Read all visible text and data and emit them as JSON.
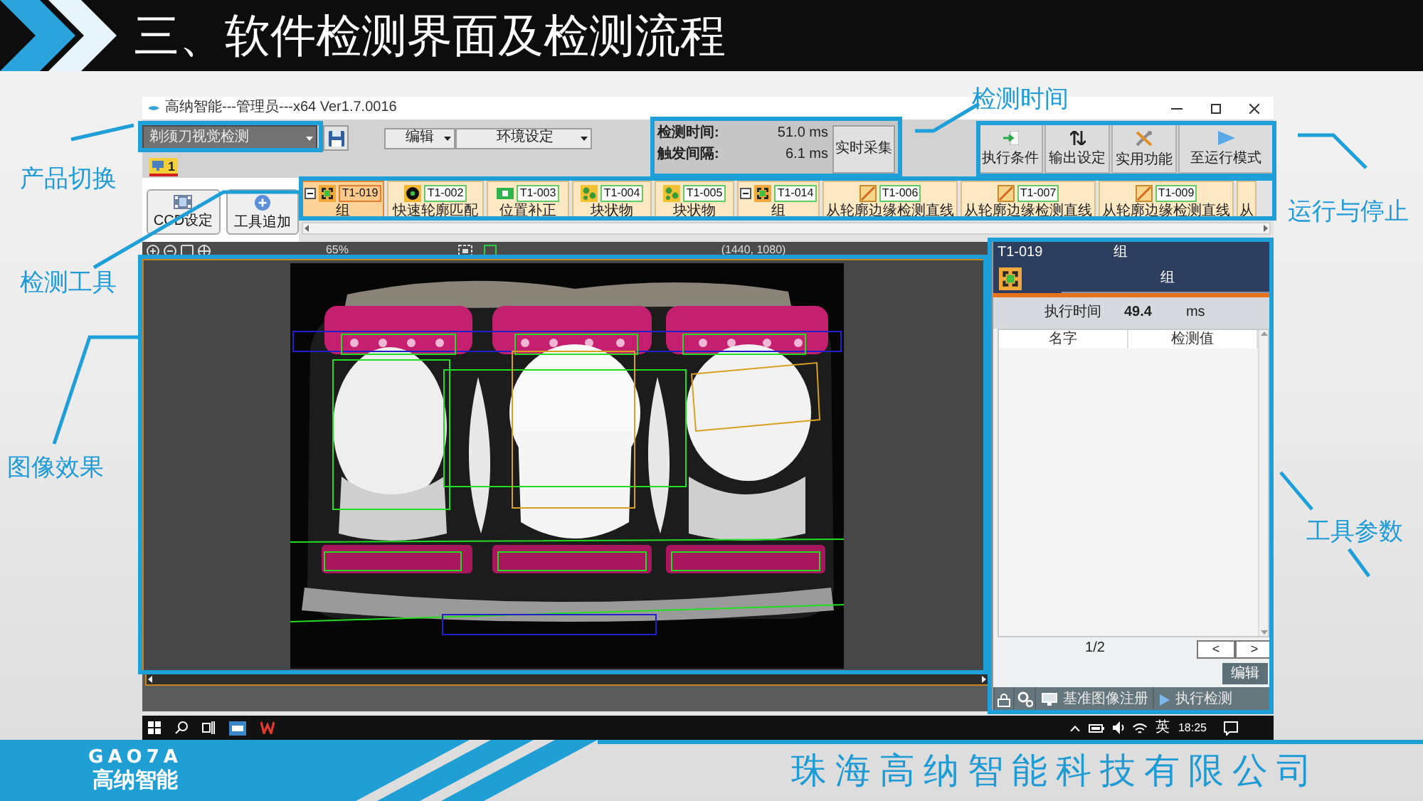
{
  "slide": {
    "title": "三、软件检测界面及检测流程"
  },
  "callouts": [
    {
      "text": "检测时间"
    },
    {
      "text": "产品切换"
    },
    {
      "text": "运行与停止"
    },
    {
      "text": "检测工具"
    },
    {
      "text": "图像效果"
    },
    {
      "text": "工具参数"
    }
  ],
  "window": {
    "title": "高纳智能---管理员---x64 Ver1.7.0016"
  },
  "toolbar": {
    "product": "剃须刀视觉检测",
    "menus": [
      "编辑",
      "环境设定"
    ],
    "stats": [
      {
        "label": "检测时间:",
        "value": "51.0 ms"
      },
      {
        "label": "触发间隔:",
        "value": "6.1 ms"
      }
    ],
    "live_button": "实时采集",
    "actions": [
      {
        "label": "执行条件",
        "kind": "condition"
      },
      {
        "label": "输出设定",
        "kind": "output"
      },
      {
        "label": "实用功能",
        "kind": "tools"
      },
      {
        "label": "至运行模式",
        "kind": "run"
      }
    ]
  },
  "page_tabs": [
    {
      "label": "1",
      "selected": true
    }
  ],
  "side_buttons": [
    {
      "label": "CCD设定",
      "kind": "ccd"
    },
    {
      "label": "工具追加",
      "kind": "add"
    }
  ],
  "tools": [
    {
      "id": "T1-019",
      "label": "组",
      "kind": "group",
      "selected": true
    },
    {
      "id": "T1-002",
      "label": "快速轮廓匹配",
      "kind": "match",
      "selected": false
    },
    {
      "id": "T1-003",
      "label": "位置补正",
      "kind": "position",
      "selected": false
    },
    {
      "id": "T1-004",
      "label": "块状物",
      "kind": "blob",
      "selected": false
    },
    {
      "id": "T1-005",
      "label": "块状物",
      "kind": "blob",
      "selected": false
    },
    {
      "id": "T1-014",
      "label": "组",
      "kind": "group",
      "selected": false
    },
    {
      "id": "T1-006",
      "label": "从轮廓边缘检测直线",
      "kind": "line",
      "selected": false
    },
    {
      "id": "T1-007",
      "label": "从轮廓边缘检测直线",
      "kind": "line",
      "selected": false
    },
    {
      "id": "T1-009",
      "label": "从轮廓边缘检测直线",
      "kind": "line",
      "selected": false
    },
    {
      "label": "从",
      "selected": false
    }
  ],
  "viewer": {
    "zoom": "65%",
    "size": "(1440, 1080)"
  },
  "panel": {
    "id": "T1-019",
    "title": "组",
    "tab": "组",
    "exec_label": "执行时间",
    "exec_value": "49.4",
    "exec_unit": "ms",
    "columns": [
      "名字",
      "检测值"
    ],
    "page": "1/2",
    "prev": "<",
    "next": ">",
    "edit": "编辑",
    "buttons": [
      {
        "label": "基准图像注册",
        "kind": "register"
      },
      {
        "label": "执行检测",
        "kind": "run"
      }
    ]
  },
  "taskbar": {
    "ime": "英",
    "time": "18:25"
  },
  "footer": {
    "logo": "GAO7A",
    "brand": "高纳智能",
    "company": "珠海高纳智能科技有限公司"
  }
}
